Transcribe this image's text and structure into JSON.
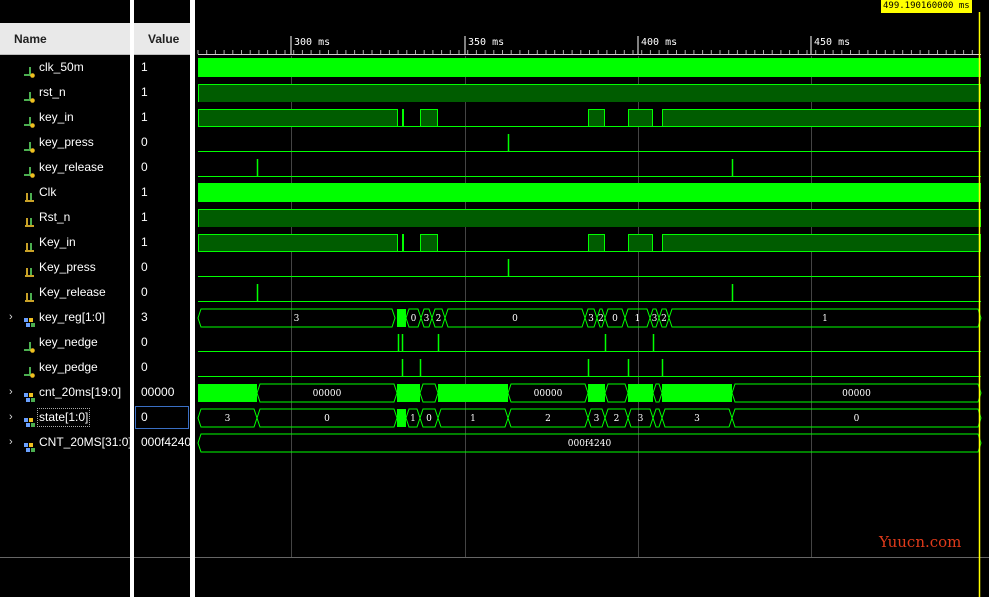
{
  "colors": {
    "wave_green": "#00ff00",
    "wave_dark": "#005c00",
    "grid": "#3b3b3b",
    "cursor": "#ffff00",
    "background": "#000000",
    "header_bg": "#e9e9e9"
  },
  "headers": {
    "name": "Name",
    "value": "Value"
  },
  "cursor_time": "499.190160000 ms",
  "ruler_labels": [
    "300 ms",
    "350 ms",
    "400 ms",
    "450 ms"
  ],
  "watermark": "Yuucn.com",
  "signals": [
    {
      "name": "clk_50m",
      "value": "1",
      "icon": "wire-input-icon",
      "expandable": false
    },
    {
      "name": "rst_n",
      "value": "1",
      "icon": "wire-input-icon",
      "expandable": false
    },
    {
      "name": "key_in",
      "value": "1",
      "icon": "wire-input-icon",
      "expandable": false
    },
    {
      "name": "key_press",
      "value": "0",
      "icon": "wire-input-icon",
      "expandable": false
    },
    {
      "name": "key_release",
      "value": "0",
      "icon": "wire-input-icon",
      "expandable": false
    },
    {
      "name": "Clk",
      "value": "1",
      "icon": "wire-signal-icon",
      "expandable": false
    },
    {
      "name": "Rst_n",
      "value": "1",
      "icon": "wire-signal-icon",
      "expandable": false
    },
    {
      "name": "Key_in",
      "value": "1",
      "icon": "wire-signal-icon",
      "expandable": false
    },
    {
      "name": "Key_press",
      "value": "0",
      "icon": "wire-signal-icon",
      "expandable": false
    },
    {
      "name": "Key_release",
      "value": "0",
      "icon": "wire-signal-icon",
      "expandable": false
    },
    {
      "name": "key_reg[1:0]",
      "value": "3",
      "icon": "bus-icon",
      "expandable": true
    },
    {
      "name": "key_nedge",
      "value": "0",
      "icon": "wire-input-icon",
      "expandable": false
    },
    {
      "name": "key_pedge",
      "value": "0",
      "icon": "wire-input-icon",
      "expandable": false
    },
    {
      "name": "cnt_20ms[19:0]",
      "value": "00000",
      "icon": "bus-icon",
      "expandable": true
    },
    {
      "name": "state[1:0]",
      "value": "0",
      "icon": "bus-icon",
      "expandable": true
    },
    {
      "name": "CNT_20MS[31:0]",
      "value": "000f4240",
      "icon": "bus-icon",
      "expandable": true
    }
  ],
  "bus_labels": {
    "key_reg": [
      "3",
      "0",
      "3",
      "2",
      "0",
      "3",
      "2",
      "0",
      "1",
      "3",
      "2",
      "1",
      "3"
    ],
    "cnt_20ms": [
      "00000",
      "00000",
      "00000"
    ],
    "state": [
      "3",
      "0",
      "1",
      "0",
      "1",
      "2",
      "3",
      "2",
      "3",
      "3",
      "0"
    ],
    "CNT_20MS": [
      "000f4240"
    ]
  }
}
